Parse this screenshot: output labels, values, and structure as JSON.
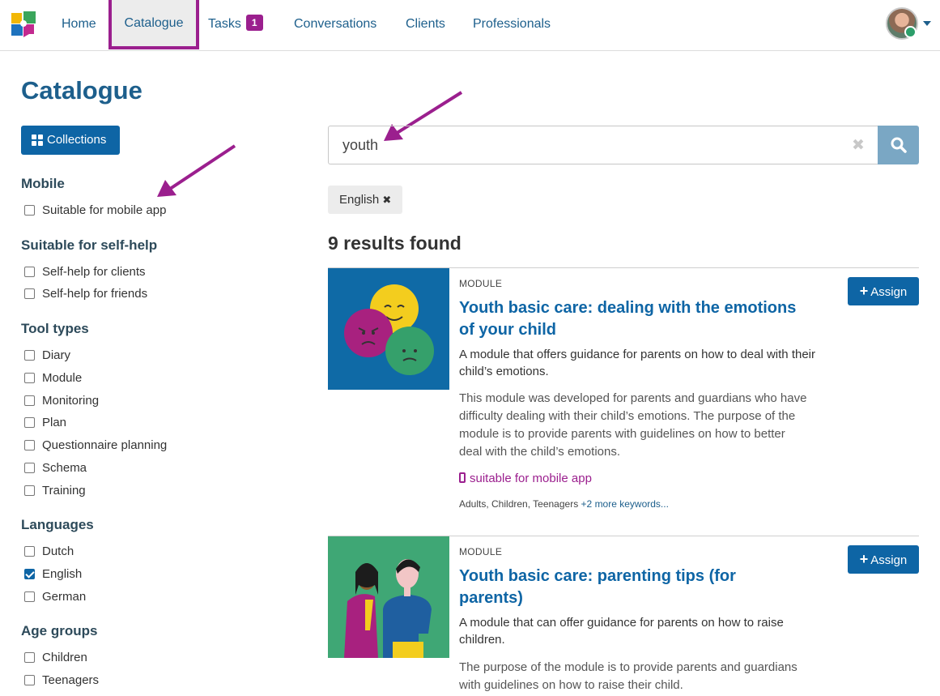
{
  "nav": {
    "items": [
      {
        "label": "Home"
      },
      {
        "label": "Catalogue"
      },
      {
        "label": "Tasks",
        "badge": "1"
      },
      {
        "label": "Conversations"
      },
      {
        "label": "Clients"
      },
      {
        "label": "Professionals"
      }
    ]
  },
  "page": {
    "title": "Catalogue",
    "collections_label": "Collections"
  },
  "filters": {
    "mobile": {
      "heading": "Mobile",
      "options": [
        {
          "label": "Suitable for mobile app",
          "checked": false
        }
      ]
    },
    "selfhelp": {
      "heading": "Suitable for self-help",
      "options": [
        {
          "label": "Self-help for clients",
          "checked": false
        },
        {
          "label": "Self-help for friends",
          "checked": false
        }
      ]
    },
    "tooltypes": {
      "heading": "Tool types",
      "options": [
        {
          "label": "Diary",
          "checked": false
        },
        {
          "label": "Module",
          "checked": false
        },
        {
          "label": "Monitoring",
          "checked": false
        },
        {
          "label": "Plan",
          "checked": false
        },
        {
          "label": "Questionnaire planning",
          "checked": false
        },
        {
          "label": "Schema",
          "checked": false
        },
        {
          "label": "Training",
          "checked": false
        }
      ]
    },
    "languages": {
      "heading": "Languages",
      "options": [
        {
          "label": "Dutch",
          "checked": false
        },
        {
          "label": "English",
          "checked": true
        },
        {
          "label": "German",
          "checked": false
        }
      ]
    },
    "agegroups": {
      "heading": "Age groups",
      "options": [
        {
          "label": "Children",
          "checked": false
        },
        {
          "label": "Teenagers",
          "checked": false
        }
      ]
    }
  },
  "search": {
    "value": "youth",
    "clear_glyph": "✖",
    "active_chip": "English",
    "chip_remove_glyph": "✖"
  },
  "results": {
    "count_text": "9 results found",
    "items": [
      {
        "type": "MODULE",
        "title": "Youth basic care: dealing with the emotions of your child",
        "summary": "A module that offers guidance for parents on how to deal with their child’s emotions.",
        "description": "This module was developed for parents and guardians who have difficulty dealing with their child’s emotions. The purpose of the module is to provide parents with guidelines on how to better deal with the child’s emotions.",
        "mobile_label": "suitable for mobile app",
        "keywords": "Adults, Children, Teenagers",
        "more_keywords": "+2 more keywords...",
        "assign_label": "Assign"
      },
      {
        "type": "MODULE",
        "title": "Youth basic care: parenting tips (for parents)",
        "summary": "A module that can offer guidance for parents on how to raise children.",
        "description": "The purpose of the module is to provide parents and guardians with guidelines on how to raise their child.",
        "assign_label": "Assign"
      }
    ]
  },
  "colors": {
    "primary": "#0e65a5",
    "accent": "#9b1f8e",
    "nav_text": "#1d5f8c"
  }
}
